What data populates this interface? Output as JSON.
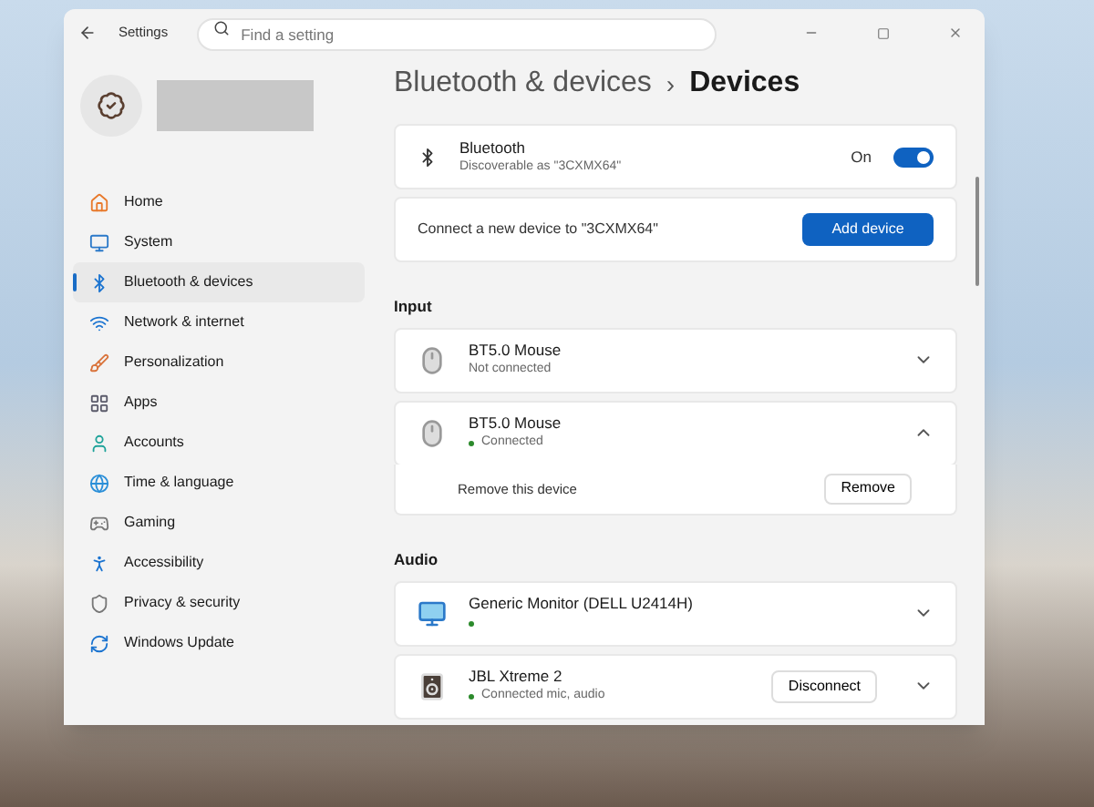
{
  "window": {
    "title": "Settings"
  },
  "search": {
    "placeholder": "Find a setting"
  },
  "sidebar": {
    "items": [
      {
        "label": "Home",
        "selected": false
      },
      {
        "label": "System",
        "selected": false
      },
      {
        "label": "Bluetooth & devices",
        "selected": true
      },
      {
        "label": "Network & internet",
        "selected": false
      },
      {
        "label": "Personalization",
        "selected": false
      },
      {
        "label": "Apps",
        "selected": false
      },
      {
        "label": "Accounts",
        "selected": false
      },
      {
        "label": "Time & language",
        "selected": false
      },
      {
        "label": "Gaming",
        "selected": false
      },
      {
        "label": "Accessibility",
        "selected": false
      },
      {
        "label": "Privacy & security",
        "selected": false
      },
      {
        "label": "Windows Update",
        "selected": false
      }
    ]
  },
  "breadcrumb": {
    "parent": "Bluetooth & devices",
    "separator": "›",
    "current": "Devices"
  },
  "bluetooth": {
    "title": "Bluetooth",
    "subtitle": "Discoverable as \"3CXMX64\"",
    "toggle_label": "On",
    "on": true
  },
  "connect": {
    "text": "Connect a new device to \"3CXMX64\"",
    "button": "Add device"
  },
  "sections": [
    {
      "title": "Input",
      "devices": [
        {
          "kind": "mouse",
          "name": "BT5.0 Mouse",
          "status": "Not connected",
          "connected": false,
          "expanded": false
        },
        {
          "kind": "mouse",
          "name": "BT5.0 Mouse",
          "status": "Connected",
          "connected": true,
          "expanded": true,
          "detail": {
            "text": "Remove this device",
            "button": "Remove"
          }
        }
      ]
    },
    {
      "title": "Audio",
      "devices": [
        {
          "kind": "monitor",
          "name": "Generic Monitor (DELL U2414H)",
          "connected": true,
          "expanded": false
        },
        {
          "kind": "speaker",
          "name": "JBL Xtreme 2",
          "status": "Connected mic, audio",
          "connected": true,
          "expanded": false,
          "button": "Disconnect"
        }
      ]
    }
  ]
}
